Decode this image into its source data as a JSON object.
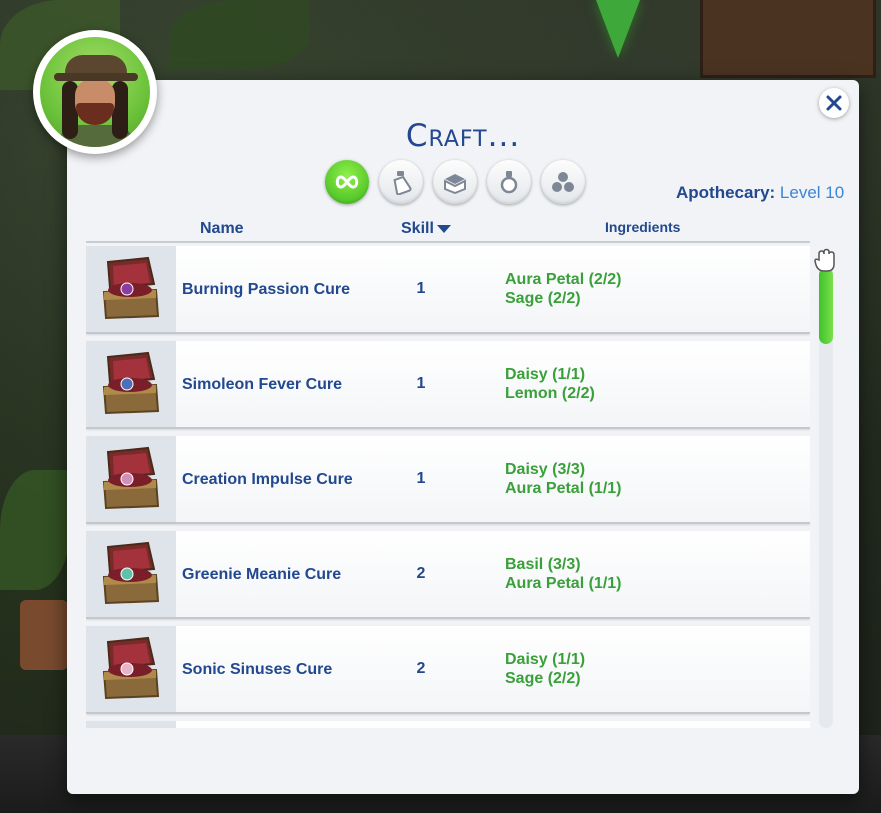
{
  "dialog": {
    "title": "Craft...",
    "close_label": "×"
  },
  "filters": [
    {
      "icon": "infinity-icon",
      "active": true
    },
    {
      "icon": "potion-bottle-icon",
      "active": false
    },
    {
      "icon": "open-chest-icon",
      "active": false
    },
    {
      "icon": "flask-icon",
      "active": false
    },
    {
      "icon": "orbs-icon",
      "active": false
    }
  ],
  "skill": {
    "label": "Apothecary:",
    "value": "Level 10"
  },
  "columns": {
    "name": "Name",
    "skill": "Skill",
    "ingredients": "Ingredients"
  },
  "recipes": [
    {
      "name": "Burning Passion Cure",
      "skill": "1",
      "ingredients": [
        "Aura Petal (2/2)",
        "Sage (2/2)"
      ],
      "gem": "#8a3d9e"
    },
    {
      "name": "Simoleon Fever Cure",
      "skill": "1",
      "ingredients": [
        "Daisy (1/1)",
        "Lemon (2/2)"
      ],
      "gem": "#4d6fb8"
    },
    {
      "name": "Creation Impulse Cure",
      "skill": "1",
      "ingredients": [
        "Daisy (3/3)",
        "Aura Petal (1/1)"
      ],
      "gem": "#d48fb8"
    },
    {
      "name": "Greenie Meanie Cure",
      "skill": "2",
      "ingredients": [
        "Basil (3/3)",
        "Aura Petal (1/1)"
      ],
      "gem": "#5fc2a8"
    },
    {
      "name": "Sonic Sinuses Cure",
      "skill": "2",
      "ingredients": [
        "Daisy (1/1)",
        "Sage (2/2)"
      ],
      "gem": "#e8b4c8"
    }
  ],
  "colors": {
    "title": "#22488f",
    "ingredient_ok": "#3aa03a",
    "accent_green": "#3fc22c",
    "level_value": "#3a86d6"
  }
}
